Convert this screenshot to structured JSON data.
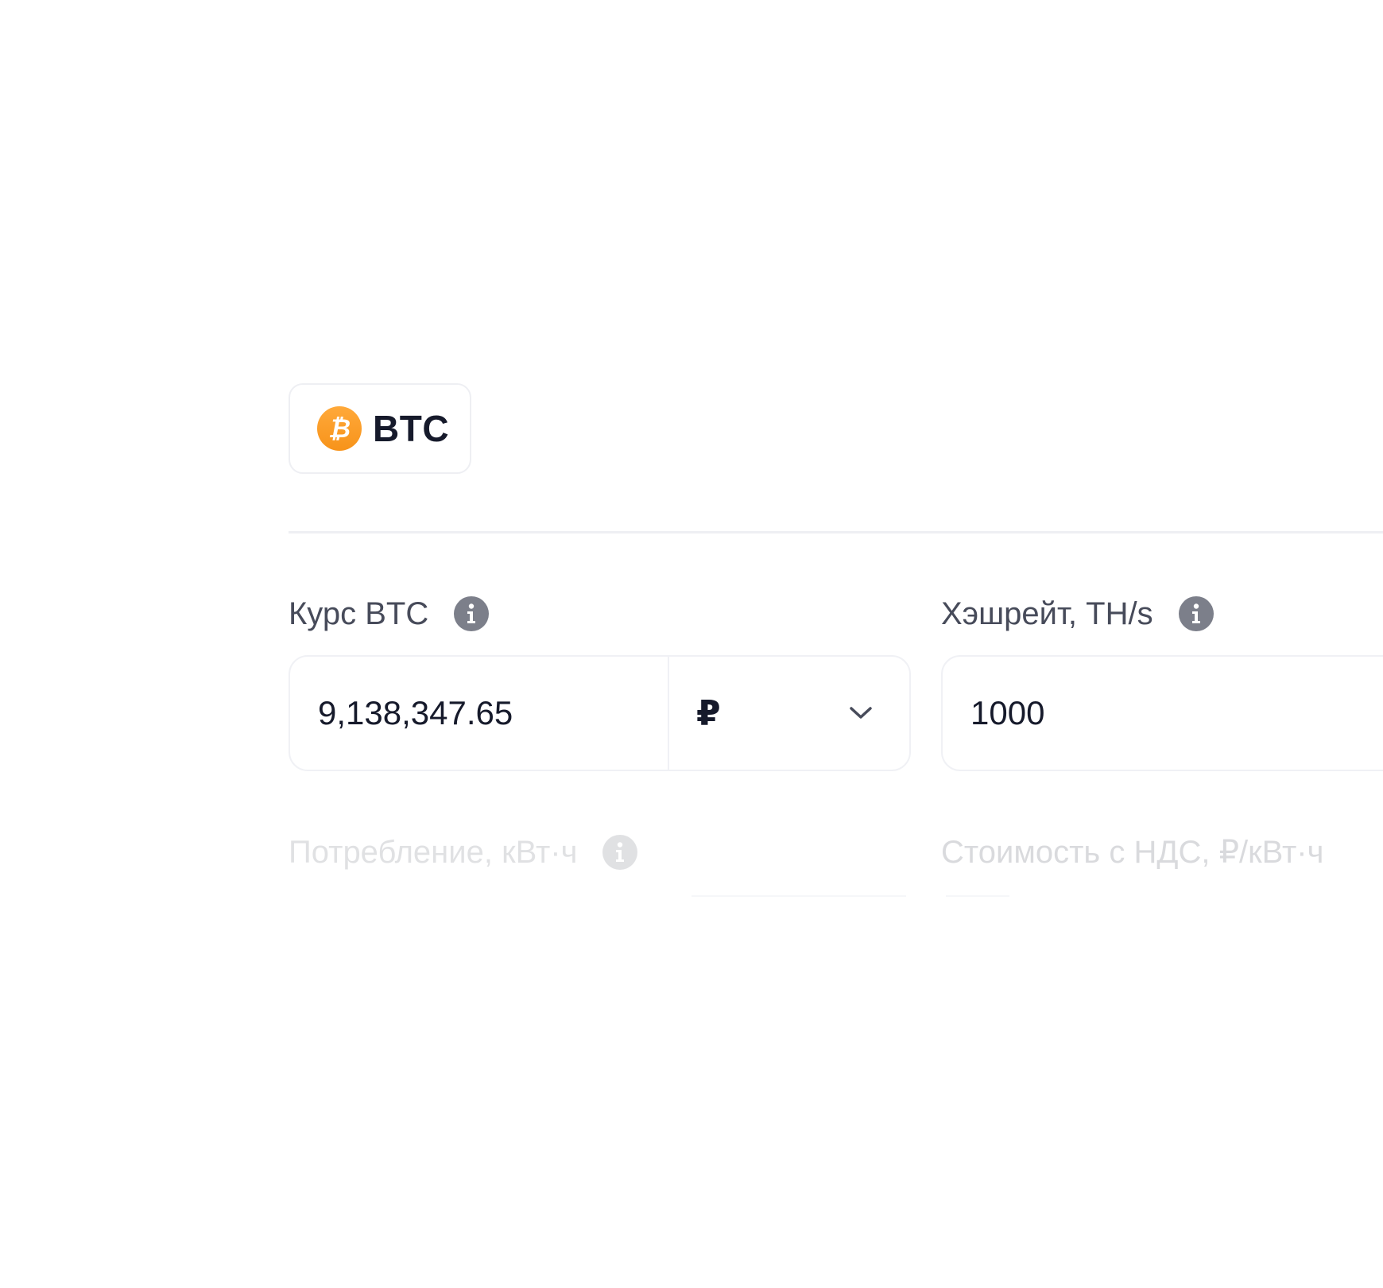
{
  "coin_tab": {
    "label": "BTC",
    "icon": "bitcoin-icon",
    "icon_color": "#F7931A"
  },
  "fields": {
    "rate": {
      "label": "Курс BTC",
      "value": "9,138,347.65",
      "currency": "₽",
      "info_icon": "info-icon"
    },
    "hashrate": {
      "label": "Хэшрейт, TH/s",
      "value": "1000",
      "info_icon": "info-icon"
    },
    "consumption": {
      "label": "Потребление, кВт·ч",
      "info_icon": "info-icon"
    },
    "cost": {
      "label": "Стоимость с НДС, ₽/кВт·ч"
    }
  },
  "colors": {
    "text_primary": "#161A2B",
    "text_label": "#474B5A",
    "info_icon": "#7C7F8A",
    "border": "#EEEFF3",
    "bitcoin_orange": "#F7931A"
  }
}
